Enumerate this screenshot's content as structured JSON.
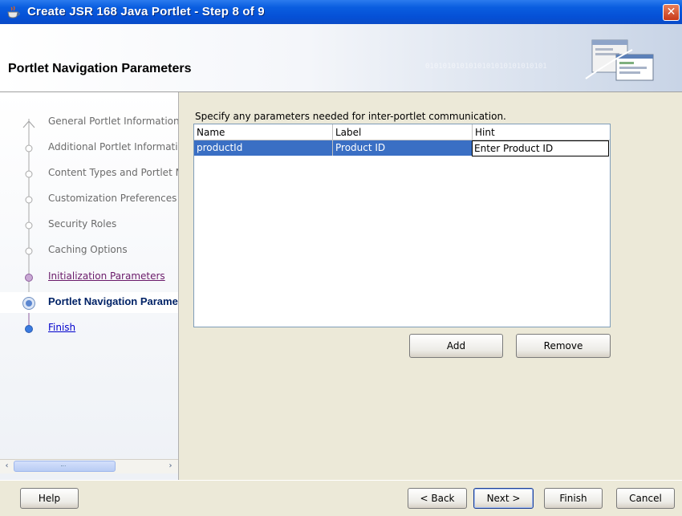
{
  "window": {
    "title": "Create JSR 168 Java Portlet - Step 8 of 9",
    "close_symbol": "✕"
  },
  "header": {
    "title": "Portlet Navigation Parameters",
    "binary_decoration": "0101010101010101010101010101"
  },
  "nav": {
    "items": [
      {
        "label": "General Portlet Information",
        "state": "done"
      },
      {
        "label": "Additional Portlet Information",
        "state": "done"
      },
      {
        "label": "Content Types and Portlet Modes",
        "state": "done"
      },
      {
        "label": "Customization Preferences",
        "state": "done"
      },
      {
        "label": "Security Roles",
        "state": "done"
      },
      {
        "label": "Caching Options",
        "state": "done"
      },
      {
        "label": "Initialization Parameters",
        "state": "visited"
      },
      {
        "label": "Portlet Navigation Parameters",
        "state": "current"
      },
      {
        "label": "Finish",
        "state": "next"
      }
    ],
    "scrollbar": {
      "left_arrow": "‹",
      "right_arrow": "›"
    }
  },
  "main": {
    "instructions": "Specify any parameters needed for inter-portlet communication.",
    "table": {
      "columns": [
        "Name",
        "Label",
        "Hint"
      ],
      "rows": [
        {
          "name": "productId",
          "label": "Product ID",
          "hint": "Enter Product ID"
        }
      ]
    },
    "add_label": "Add",
    "remove_label": "Remove"
  },
  "footer": {
    "help_label": "Help",
    "back_label": "< Back",
    "next_label": "Next >",
    "finish_label": "Finish",
    "cancel_label": "Cancel"
  },
  "icons": {
    "app": "coffee-cup-icon",
    "close": "close-icon",
    "header": "wizard-document-icon"
  },
  "colors": {
    "titlebar": "#0550D6",
    "selection": "#3A6FC4",
    "close": "#C7391A",
    "nav_done": "#6B6B6B",
    "nav_visited": "#6A1A6A",
    "nav_current": "#002266",
    "nav_next": "#0000CC"
  }
}
